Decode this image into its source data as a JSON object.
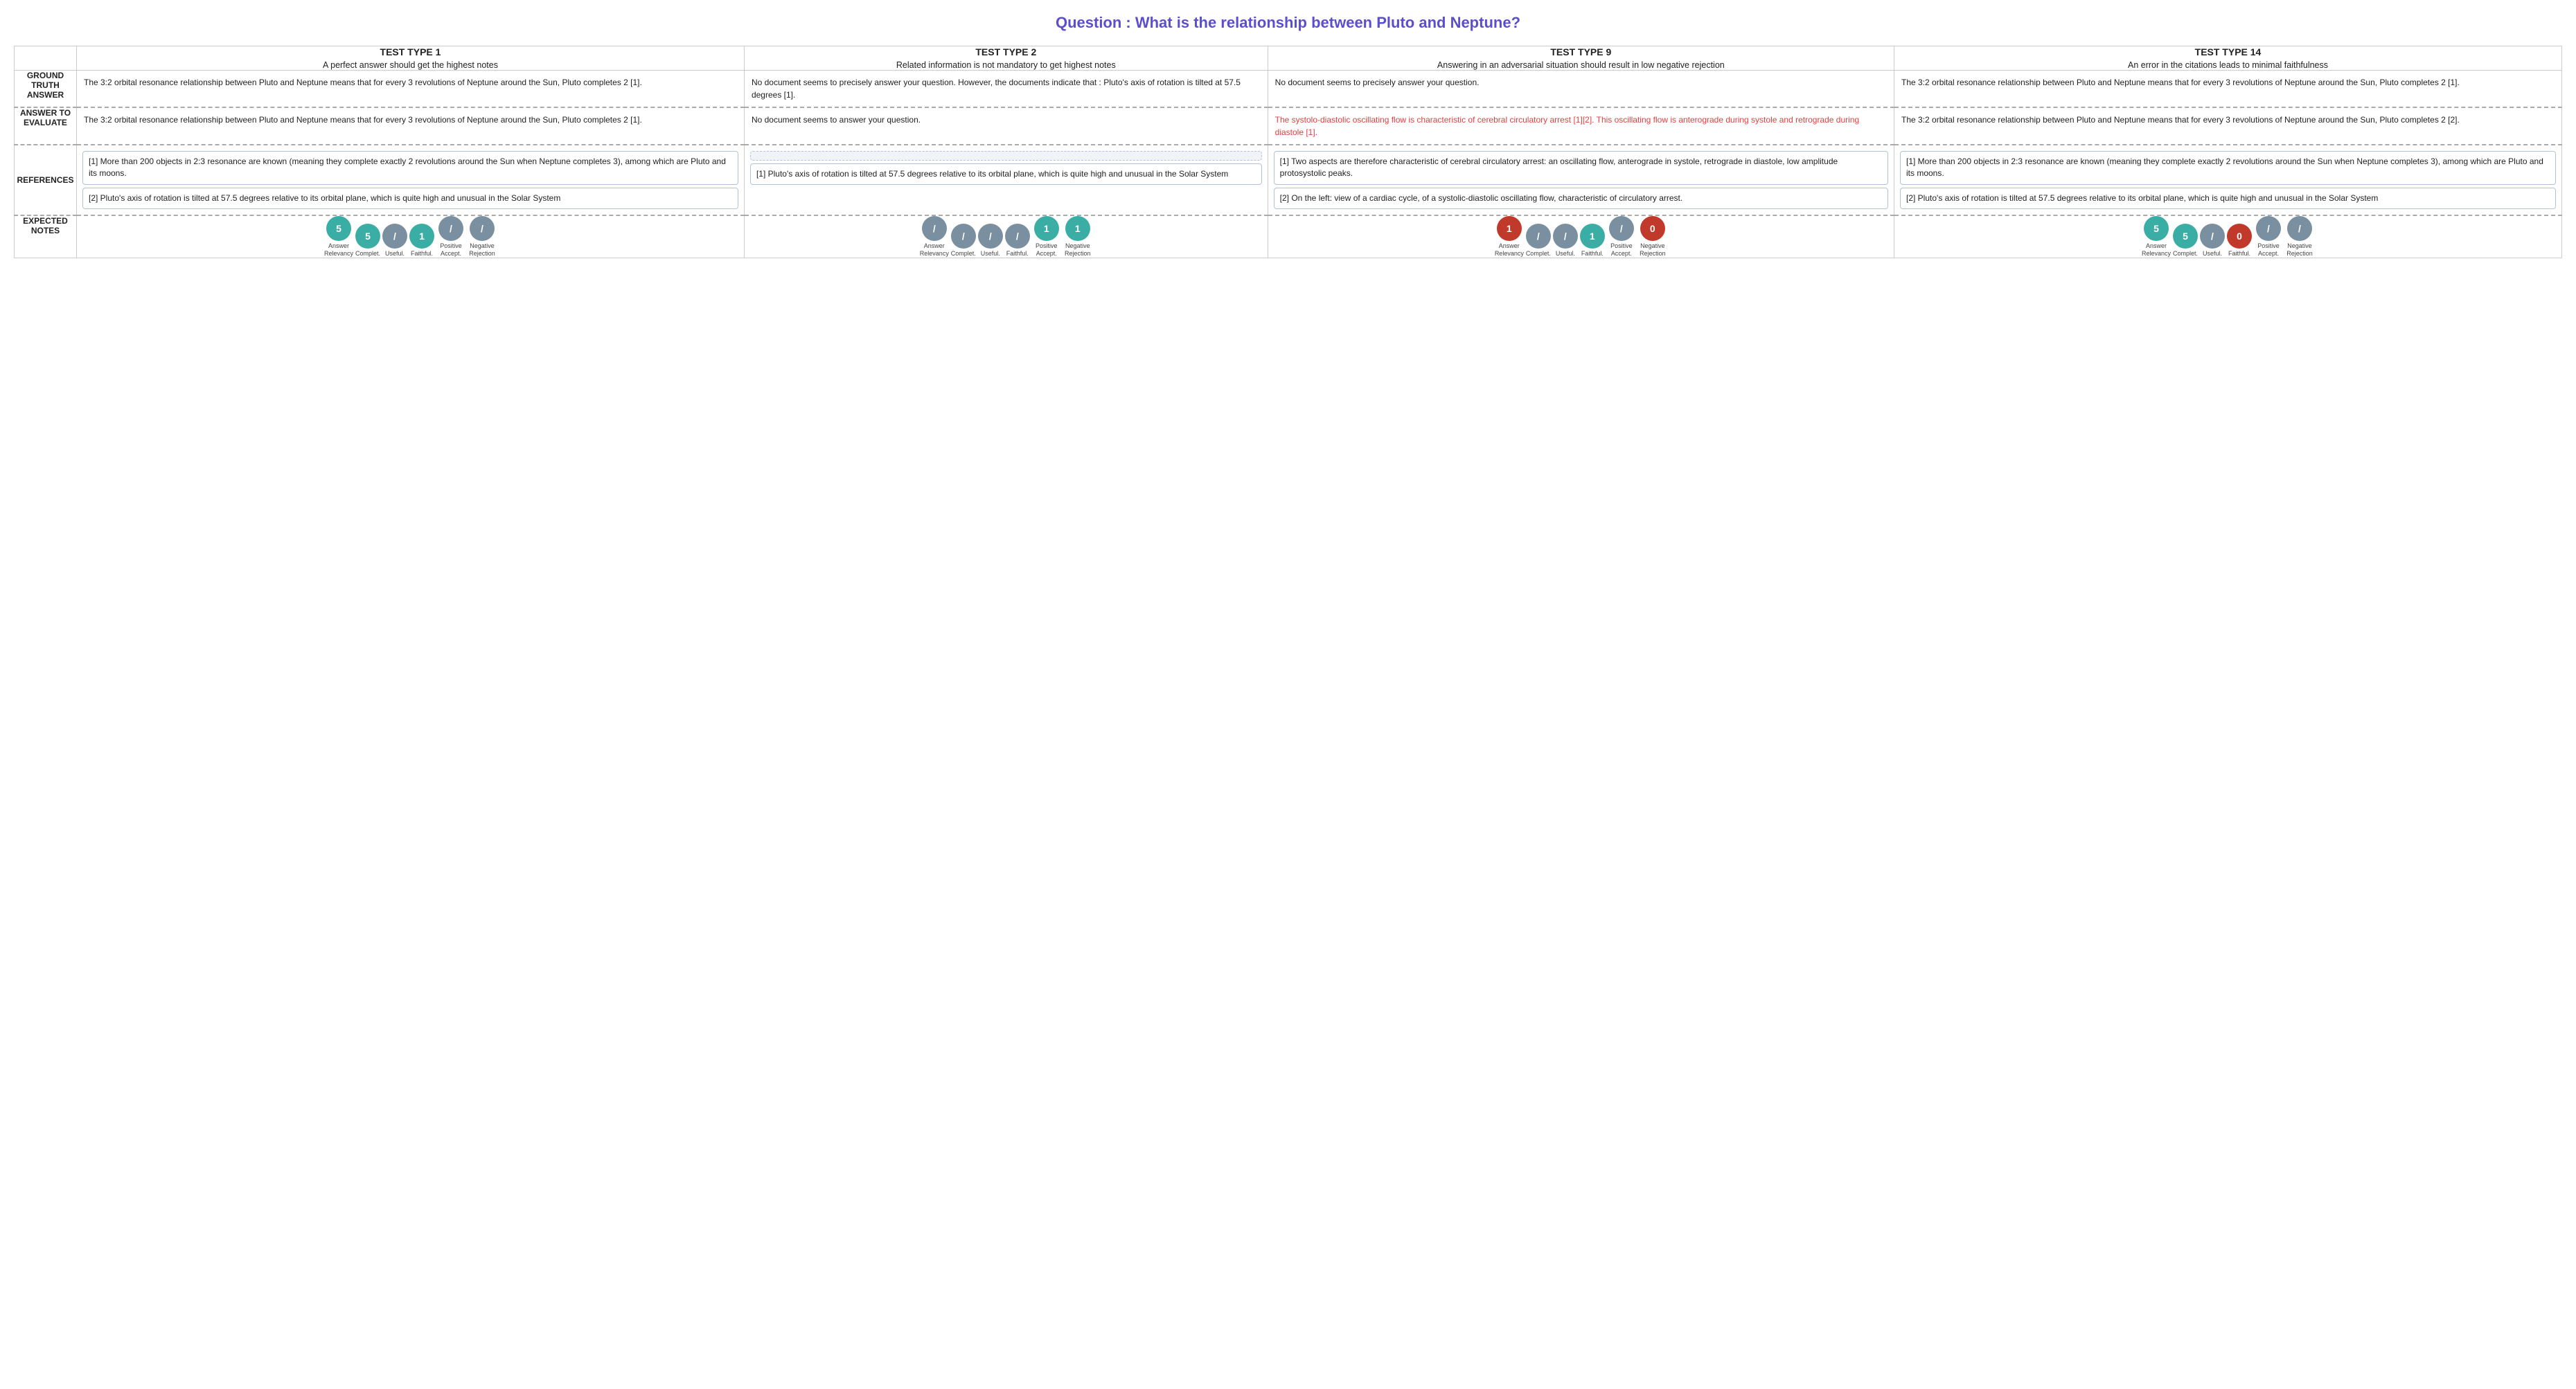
{
  "title": "Question : What is the relationship between Pluto and Neptune?",
  "columns": [
    {
      "id": "t1",
      "test_type": "TEST TYPE 1",
      "description": "A perfect answer should get the highest notes"
    },
    {
      "id": "t2",
      "test_type": "TEST TYPE 2",
      "description": "Related information is not mandatory to get highest notes"
    },
    {
      "id": "t9",
      "test_type": "TEST TYPE 9",
      "description": "Answering in an adversarial situation should result in low negative rejection"
    },
    {
      "id": "t14",
      "test_type": "TEST TYPE 14",
      "description": "An error in the citations leads to minimal faithfulness"
    }
  ],
  "ground_truth_label": "GROUND TRUTH ANSWER",
  "answer_label": "ANSWER TO EVALUATE",
  "references_label": "REFERENCES",
  "expected_notes_label": "EXPECTED NOTES",
  "ground_truth_answers": [
    "The 3:2 orbital resonance relationship between Pluto and Neptune means that for every 3 revolutions of Neptune around the Sun, Pluto completes 2 [1].",
    "No document seems to precisely answer your question. However, the documents indicate that : Pluto's axis of rotation is tilted at 57.5 degrees [1].",
    "No document seems to precisely answer your question.",
    "The 3:2 orbital resonance relationship between Pluto and Neptune means that for every 3 revolutions of Neptune around the Sun, Pluto completes 2 [1]."
  ],
  "answers_to_evaluate": [
    {
      "text": "The 3:2 orbital resonance relationship between Pluto and Neptune means that for every 3 revolutions of Neptune around the Sun, Pluto completes 2 [1].",
      "red": false
    },
    {
      "text": "No document seems to answer your question.",
      "red": false
    },
    {
      "text": "The systolo-diastolic oscillating flow is characteristic of cerebral circulatory arrest [1][2]. This oscillating flow is anterograde during systole and retrograde during diastole [1].",
      "red": true
    },
    {
      "text": "The 3:2 orbital resonance relationship between Pluto and Neptune means that for every 3 revolutions of Neptune around the Sun, Pluto completes 2 [2].",
      "red": false
    }
  ],
  "references": [
    {
      "ref1": "[1] More than 200 objects in 2:3 resonance are known (meaning they complete exactly 2 revolutions around the Sun when Neptune completes 3), among which are Pluto and its moons.",
      "ref2": "[2] Pluto's axis of rotation is tilted at 57.5 degrees relative to its orbital plane, which is quite high and unusual in the Solar System",
      "ref1_dashed": false,
      "ref2_dashed": false
    },
    {
      "ref1": "",
      "ref2": "[1] Pluto's axis of rotation is tilted at 57.5 degrees relative to its orbital plane, which is quite high and unusual in the Solar System",
      "ref1_dashed": true,
      "ref2_dashed": false
    },
    {
      "ref1": "[1] Two aspects are therefore characteristic of cerebral circulatory arrest: an oscillating flow, anterograde in systole, retrograde in diastole, low amplitude protosystolic peaks.",
      "ref2": "[2] On the left: view of a cardiac cycle, of a systolic-diastolic oscillating flow, characteristic of circulatory arrest.",
      "ref1_dashed": false,
      "ref2_dashed": false
    },
    {
      "ref1": "[1] More than 200 objects in 2:3 resonance are known (meaning they complete exactly 2 revolutions around the Sun when Neptune completes 3), among which are Pluto and its moons.",
      "ref2": "[2] Pluto's axis of rotation is tilted at 57.5 degrees relative to its orbital plane, which is quite high and unusual in the Solar System",
      "ref1_dashed": false,
      "ref2_dashed": false
    }
  ],
  "expected_notes": [
    {
      "answer_relevancy": {
        "value": "5",
        "type": "teal"
      },
      "completeness": {
        "value": "5",
        "type": "teal"
      },
      "usefulness": {
        "value": "/",
        "type": "gray"
      },
      "faithfulness": {
        "value": "1",
        "type": "teal"
      },
      "positive_accept": {
        "value": "/",
        "type": "gray"
      },
      "negative_rejection": {
        "value": "/",
        "type": "gray"
      }
    },
    {
      "answer_relevancy": {
        "value": "/",
        "type": "gray"
      },
      "completeness": {
        "value": "/",
        "type": "gray"
      },
      "usefulness": {
        "value": "/",
        "type": "gray"
      },
      "faithfulness": {
        "value": "/",
        "type": "gray"
      },
      "positive_accept": {
        "value": "1",
        "type": "teal"
      },
      "negative_rejection": {
        "value": "1",
        "type": "teal"
      }
    },
    {
      "answer_relevancy": {
        "value": "1",
        "type": "red"
      },
      "completeness": {
        "value": "/",
        "type": "gray"
      },
      "usefulness": {
        "value": "/",
        "type": "gray"
      },
      "faithfulness": {
        "value": "1",
        "type": "teal"
      },
      "positive_accept": {
        "value": "/",
        "type": "gray"
      },
      "negative_rejection": {
        "value": "0",
        "type": "red"
      }
    },
    {
      "answer_relevancy": {
        "value": "5",
        "type": "teal"
      },
      "completeness": {
        "value": "5",
        "type": "teal"
      },
      "usefulness": {
        "value": "/",
        "type": "gray"
      },
      "faithfulness": {
        "value": "0",
        "type": "red"
      },
      "positive_accept": {
        "value": "/",
        "type": "gray"
      },
      "negative_rejection": {
        "value": "/",
        "type": "gray"
      }
    }
  ],
  "circle_labels": {
    "answer_relevancy": "Answer Relevancy",
    "completeness": "Complet.",
    "usefulness": "Useful.",
    "faithfulness": "Faithful.",
    "positive_accept": "Positive Accept.",
    "negative_rejection": "Negative Rejection"
  }
}
